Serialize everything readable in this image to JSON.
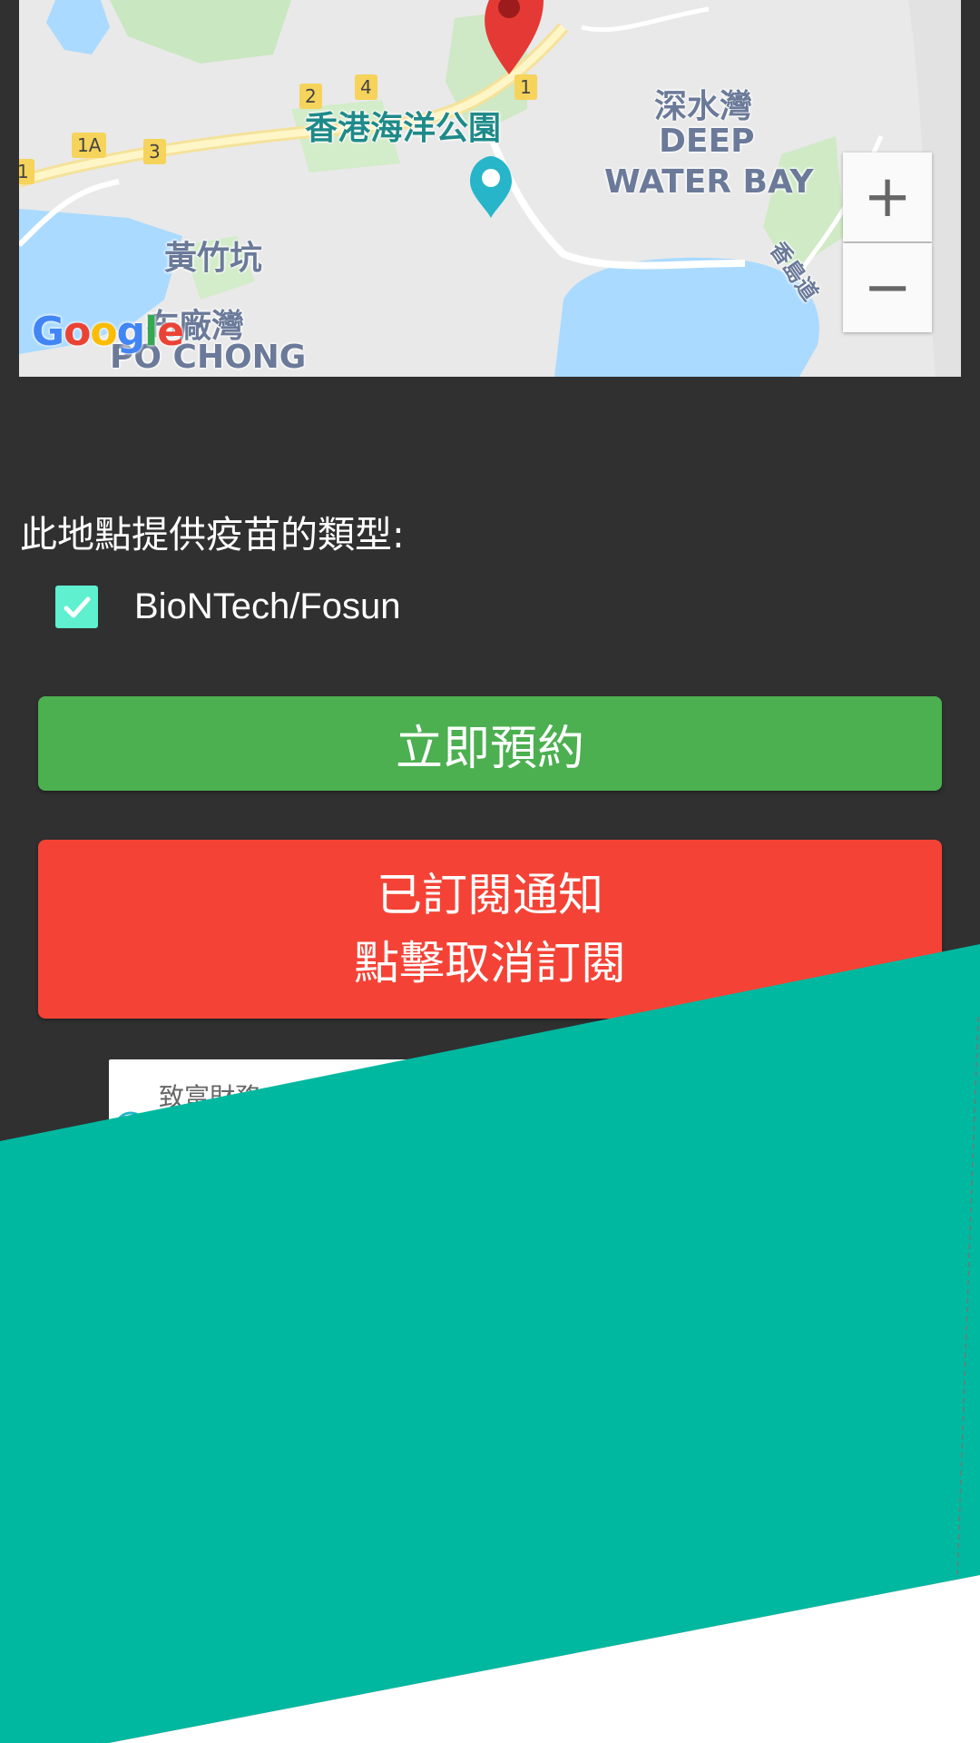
{
  "map": {
    "labels": {
      "ocean_park": "香港海洋公園",
      "deep_water_bay_zh": "深水灣",
      "deep_water_bay_en_1": "DEEP",
      "deep_water_bay_en_2": "WATER BAY",
      "wong_chuk_hang": "黃竹坑",
      "po_chong_zh": "布廠灣",
      "po_chong_en": "PO CHONG",
      "island_road": "香島道"
    },
    "road_badges": [
      "1A",
      "3",
      "2",
      "4",
      "1",
      "1"
    ],
    "zoom_in_label": "+",
    "zoom_out_label": "−",
    "logo_text": "Google",
    "logo_colors": [
      "#4285f4",
      "#ea4335",
      "#fbbc05",
      "#4285f4",
      "#34a853",
      "#ea4335"
    ]
  },
  "vaccine_types": {
    "heading": "此地點提供疫苗的類型:",
    "items": [
      {
        "label": "BioNTech/Fosun",
        "checked": true
      }
    ]
  },
  "actions": {
    "book_label": "立即預約",
    "unsubscribe_line1": "已訂閱通知",
    "unsubscribe_line2": "點擊取消訂閱"
  },
  "partial_card": {
    "text": "致富財務"
  },
  "colors": {
    "background": "#303030",
    "book_button": "#4caf50",
    "unsubscribe_button": "#f44336",
    "checkbox": "#5ff0d0",
    "overlay": "#00b8a0",
    "map_pin": "#e53935",
    "park_marker": "#26b5c9"
  }
}
